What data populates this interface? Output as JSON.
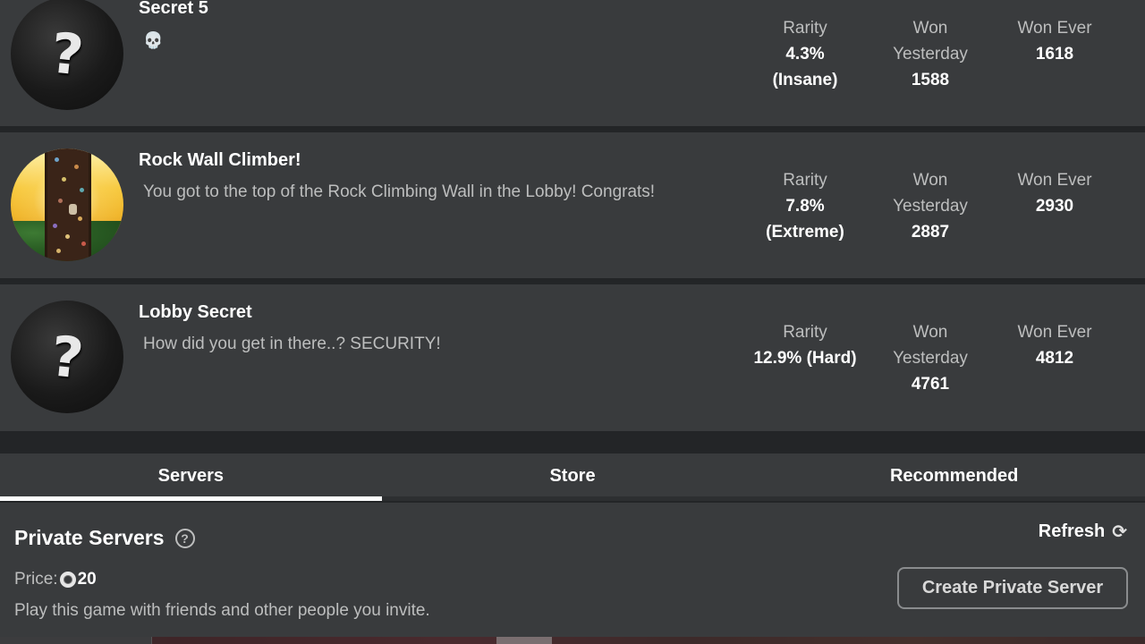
{
  "badges": [
    {
      "title": "Secret 5",
      "icon": "mystery-question-icon",
      "description_icon": "skull-icon",
      "description_glyph": "💀",
      "description": "",
      "stats": {
        "rarity_label": "Rarity",
        "rarity_value": "4.3%",
        "rarity_tier": "(Insane)",
        "won_yesterday_label_1": "Won",
        "won_yesterday_label_2": "Yesterday",
        "won_yesterday_value": "1588",
        "won_ever_label": "Won Ever",
        "won_ever_value": "1618"
      }
    },
    {
      "title": "Rock Wall Climber!",
      "icon": "rock-wall-badge-icon",
      "description": "You got to the top of the Rock Climbing Wall in the Lobby! Congrats!",
      "stats": {
        "rarity_label": "Rarity",
        "rarity_value": "7.8%",
        "rarity_tier": "(Extreme)",
        "won_yesterday_label_1": "Won",
        "won_yesterday_label_2": "Yesterday",
        "won_yesterday_value": "2887",
        "won_ever_label": "Won Ever",
        "won_ever_value": "2930"
      }
    },
    {
      "title": "Lobby Secret",
      "icon": "mystery-question-icon",
      "description": "How did you get in there..? SECURITY!",
      "stats": {
        "rarity_label": "Rarity",
        "rarity_value": "12.9% (Hard)",
        "won_yesterday_label_1": "Won",
        "won_yesterday_label_2": "Yesterday",
        "won_yesterday_value": "4761",
        "won_ever_label": "Won Ever",
        "won_ever_value": "4812"
      }
    }
  ],
  "tabs": [
    {
      "label": "Servers",
      "active": true
    },
    {
      "label": "Store",
      "active": false
    },
    {
      "label": "Recommended",
      "active": false
    }
  ],
  "private_servers": {
    "title": "Private Servers",
    "help_glyph": "?",
    "price_label": "Price:",
    "price_currency_icon": "robux-icon",
    "price_value": "20",
    "description": "Play this game with friends and other people you invite.",
    "refresh_label": "Refresh",
    "refresh_glyph": "⟳",
    "create_button_label": "Create Private Server"
  },
  "mystery_glyph": "?",
  "colors": {
    "background": "#232527",
    "card": "#393b3d",
    "text_primary": "#ffffff",
    "text_secondary": "#bdbebe",
    "tab_active_underline": "#ffffff"
  }
}
